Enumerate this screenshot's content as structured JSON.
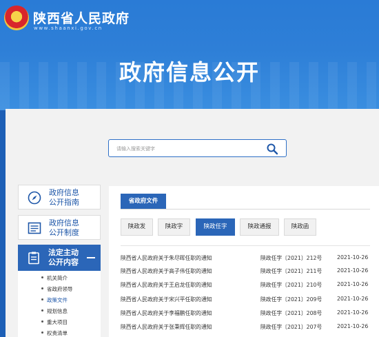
{
  "header": {
    "site_title": "陕西省人民政府",
    "site_url": "www.shaanxi.gov.cn",
    "page_title": "政府信息公开"
  },
  "search": {
    "placeholder": "请输入搜索关键字",
    "icon": "search-icon"
  },
  "sidebar": {
    "items": [
      {
        "line1": "政府信息",
        "line2": "公开指南",
        "icon": "compass-icon"
      },
      {
        "line1": "政府信息",
        "line2": "公开制度",
        "icon": "list-icon"
      },
      {
        "line1": "法定主动",
        "line2": "公开内容",
        "icon": "clipboard-icon",
        "active": true
      }
    ],
    "subitems": [
      "机关简介",
      "省政府领导",
      "政策文件",
      "规划信息",
      "重大项目",
      "权责清单"
    ],
    "current_subitem": "政策文件"
  },
  "content": {
    "section_tab": "省政府文件",
    "filters": [
      "陕政发",
      "陕政字",
      "陕政任字",
      "陕政通报",
      "陕政函"
    ],
    "active_filter": "陕政任字",
    "documents": [
      {
        "title": "陕西省人民政府关于朱尽晖任职的通知",
        "number": "陕政任字〔2021〕212号",
        "date": "2021-10-26"
      },
      {
        "title": "陕西省人民政府关于高子伟任职的通知",
        "number": "陕政任字〔2021〕211号",
        "date": "2021-10-26"
      },
      {
        "title": "陕西省人民政府关于王启龙任职的通知",
        "number": "陕政任字〔2021〕210号",
        "date": "2021-10-26"
      },
      {
        "title": "陕西省人民政府关于宋兴平任职的通知",
        "number": "陕政任字〔2021〕209号",
        "date": "2021-10-26"
      },
      {
        "title": "陕西省人民政府关于李福鹏任职的通知",
        "number": "陕政任字〔2021〕208号",
        "date": "2021-10-26"
      },
      {
        "title": "陕西省人民政府关于张秉辉任职的通知",
        "number": "陕政任字〔2021〕207号",
        "date": "2021-10-26"
      }
    ]
  },
  "colors": {
    "brand_blue": "#2b66b8",
    "banner_blue": "#2e7fd7",
    "link_blue": "#1d56a8"
  }
}
